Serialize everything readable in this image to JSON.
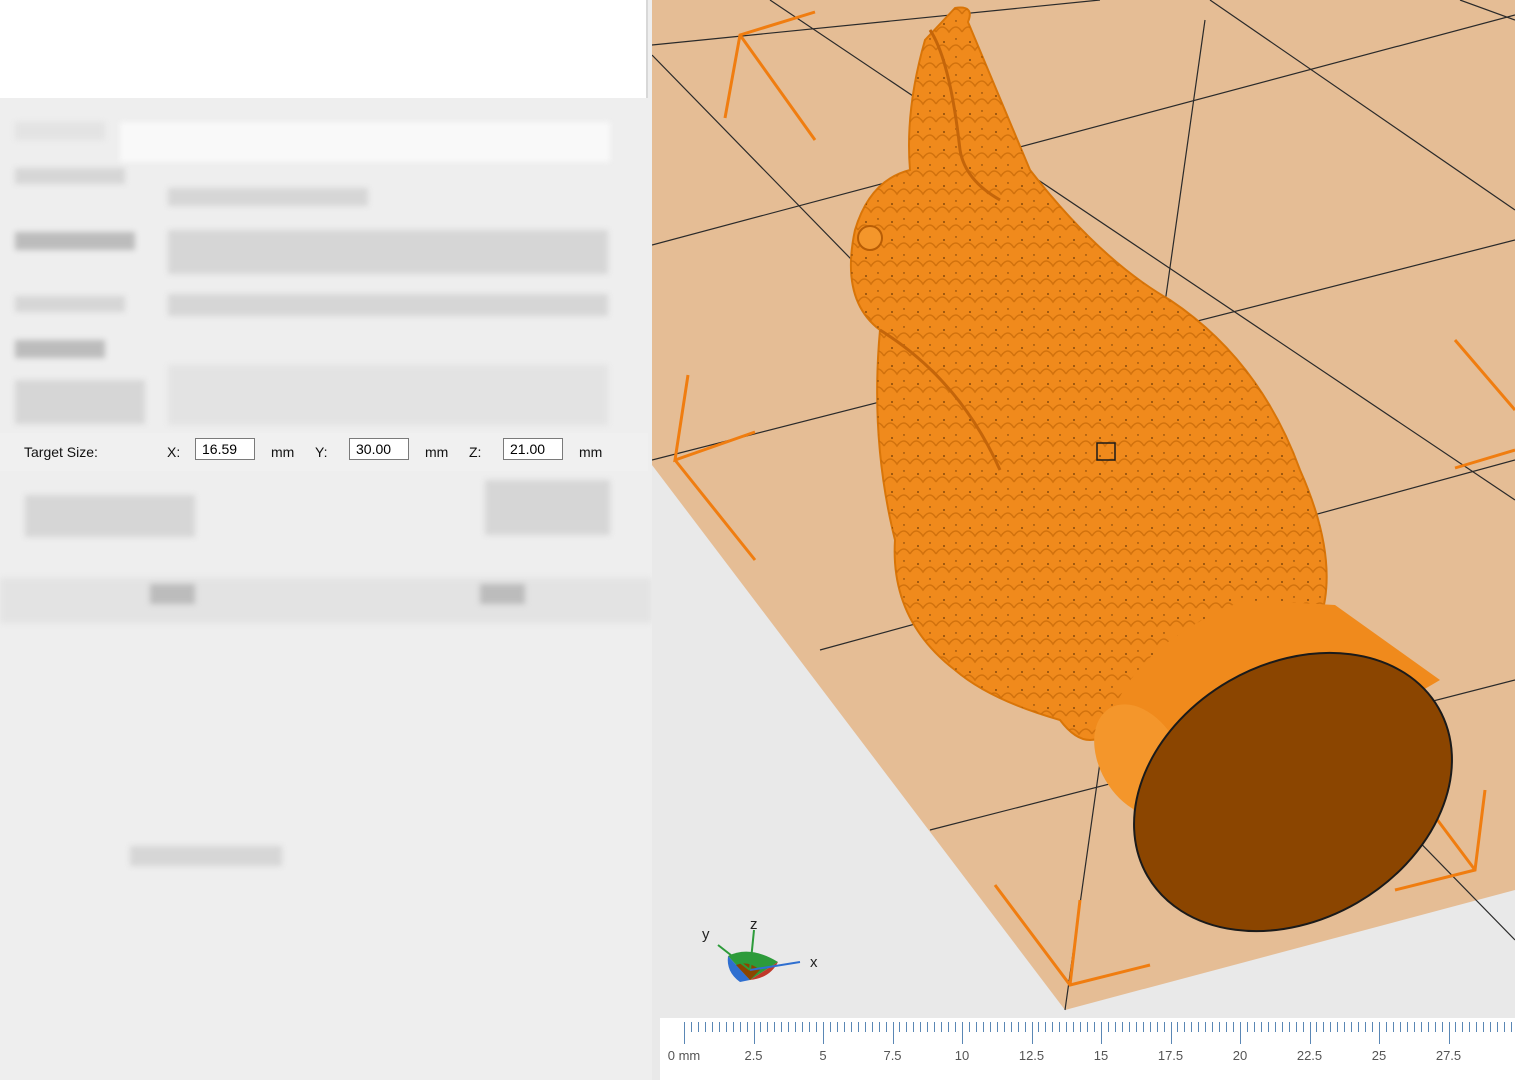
{
  "target_size": {
    "label": "Target Size:",
    "x": {
      "label": "X:",
      "value": "16.59",
      "unit": "mm"
    },
    "y": {
      "label": "Y:",
      "value": "30.00",
      "unit": "mm"
    },
    "z": {
      "label": "Z:",
      "value": "21.00",
      "unit": "mm"
    }
  },
  "axes": {
    "x": "x",
    "y": "y",
    "z": "z"
  },
  "ruler": {
    "labels": [
      "0 mm",
      "2.5",
      "5",
      "7.5",
      "10",
      "12.5",
      "15",
      "17.5",
      "20",
      "22.5",
      "25",
      "27.5"
    ]
  },
  "colors": {
    "model": "#f08a1c",
    "model_base": "#8b4500",
    "build_plate": "#e5bd95",
    "plate_arrows": "#f07d10",
    "ruler_ticks": "#5a87b5"
  }
}
